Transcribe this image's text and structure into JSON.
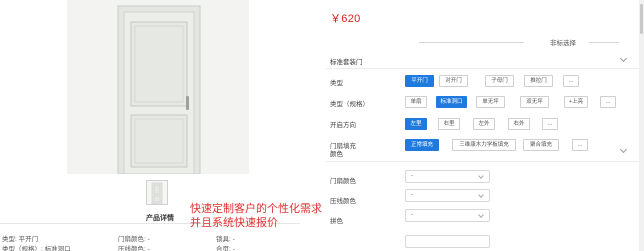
{
  "product": {
    "thumbnail_count": 1,
    "detail_title": "产品详情",
    "specs": [
      {
        "label": "类型: 平开门"
      },
      {
        "label": "门扇颜色: -"
      },
      {
        "label": "锁具: -"
      },
      {
        "label": "类型（规格）: 标准洞口"
      },
      {
        "label": "压线颜色: -"
      },
      {
        "label": "合页: -"
      }
    ]
  },
  "promo": {
    "line1": "快速定制客户的个性化需求",
    "line2": "并且系统快速报价"
  },
  "config": {
    "price": "￥620",
    "section_divider_label": "非标选择",
    "section_standard": "标准套装门",
    "groups": [
      {
        "label": "类型",
        "options": [
          {
            "text": "平开门",
            "selected": true
          },
          {
            "text": "对开门",
            "selected": false
          },
          {
            "text": "子母门",
            "selected": false
          },
          {
            "text": "推拉门",
            "selected": false
          },
          {
            "text": "...",
            "selected": false
          }
        ]
      },
      {
        "label": "类型（规格）",
        "options": [
          {
            "text": "单扇",
            "selected": false
          },
          {
            "text": "标准洞口",
            "selected": true
          },
          {
            "text": "单无坪",
            "selected": false
          },
          {
            "text": "双无坪",
            "selected": false
          },
          {
            "text": "+上亮",
            "selected": false
          },
          {
            "text": "...",
            "selected": false
          }
        ]
      },
      {
        "label": "开启方向",
        "options": [
          {
            "text": "左里",
            "selected": true
          },
          {
            "text": "右里",
            "selected": false
          },
          {
            "text": "左外",
            "selected": false
          },
          {
            "text": "右外",
            "selected": false
          },
          {
            "text": "...",
            "selected": false
          }
        ]
      },
      {
        "label": "门扇填充",
        "options": [
          {
            "text": "正常填充",
            "selected": true
          },
          {
            "text": "三维康木力学板填充",
            "selected": false
          },
          {
            "text": "聚合填充",
            "selected": false
          },
          {
            "text": "...",
            "selected": false
          }
        ]
      }
    ],
    "section_color": "颜色",
    "color_rows": [
      {
        "label": "门扇颜色",
        "value": "-"
      },
      {
        "label": "压线颜色",
        "value": "-"
      },
      {
        "label": "拼色",
        "value": "-"
      }
    ]
  },
  "colors": {
    "accent": "#1f7ae0",
    "price": "#e02020",
    "promo": "#e03131"
  }
}
